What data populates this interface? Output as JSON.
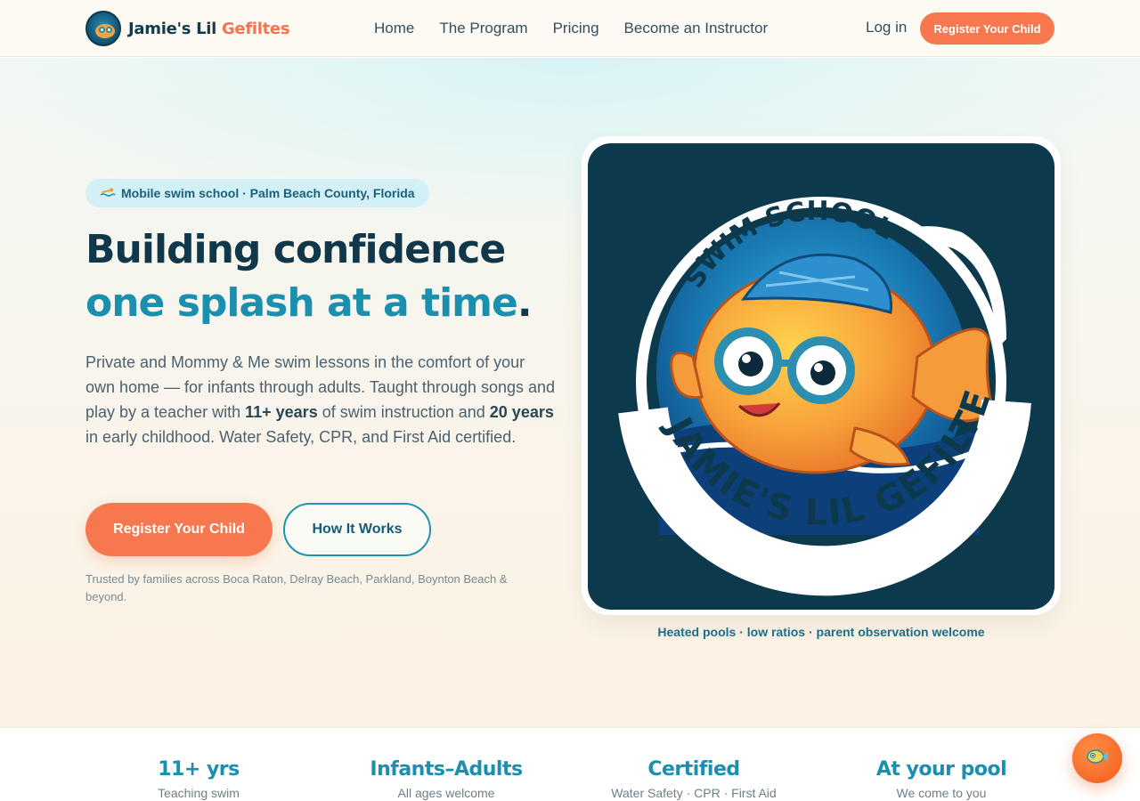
{
  "nav": {
    "brand_main": "Jamie's Lil ",
    "brand_accent": "Gefiltes",
    "links": [
      "Home",
      "The Program",
      "Pricing",
      "Become an Instructor"
    ],
    "login": "Log in",
    "cta": "Register Your Child"
  },
  "hero": {
    "pill_icon": "swimmer-icon",
    "pill_text": "Mobile swim school · Palm Beach County, Florida",
    "headline_part1": "Building confidence ",
    "headline_highlight": "one splash at a time",
    "headline_end": ".",
    "lede_1": "Private and Mommy & Me swim lessons in the comfort of your own home — for infants through adults. Taught through songs and play by a teacher with ",
    "lede_bold1": "11+ years",
    "lede_2": " of swim instruction and ",
    "lede_bold2": "20 years",
    "lede_3": " in early childhood. Water Safety, CPR, and First Aid certified.",
    "primary_button": "Register Your Child",
    "secondary_button": "How It Works",
    "trusted": "Trusted by families across Boca Raton, Delray Beach, Parkland, Boynton Beach & beyond.",
    "logo_top_text": "SWIM SCHOOL",
    "logo_bottom_text": "JAMIE'S LIL GEFILTES",
    "caption": "Heated pools · low ratios · parent observation welcome"
  },
  "stats": [
    {
      "title": "11+ yrs",
      "sub": "Teaching swim"
    },
    {
      "title": "Infants–Adults",
      "sub": "All ages welcome"
    },
    {
      "title": "Certified",
      "sub": "Water Safety · CPR · First Aid"
    },
    {
      "title": "At your pool",
      "sub": "We come to you"
    }
  ],
  "fab_icon": "fish-icon",
  "colors": {
    "accent_coral": "#f7784f",
    "accent_teal": "#1a8fae",
    "navy": "#10384a"
  }
}
